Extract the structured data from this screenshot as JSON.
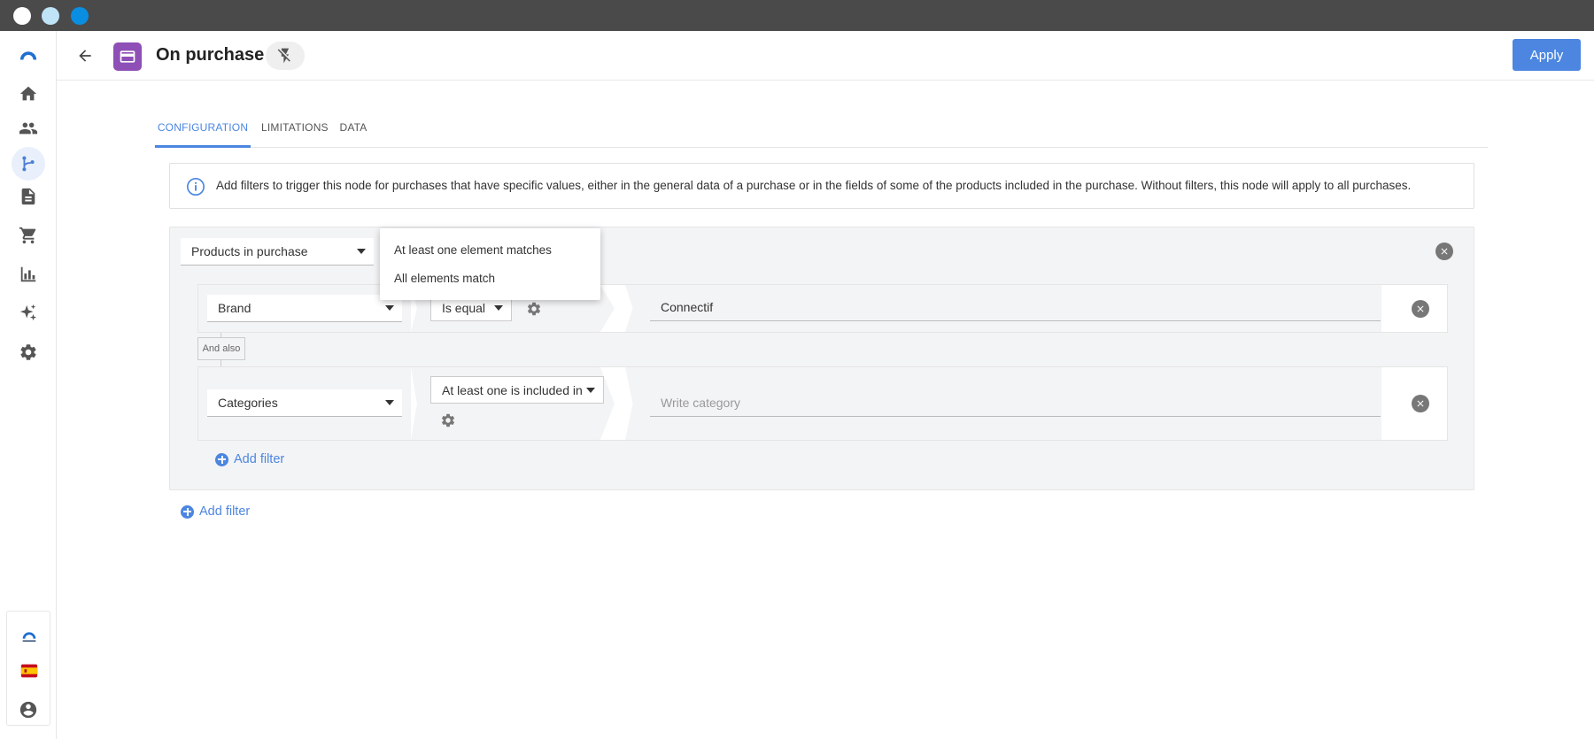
{
  "window": {
    "traffic_lights": [
      "white",
      "light-blue",
      "blue"
    ]
  },
  "header": {
    "title": "On purchase",
    "apply_label": "Apply"
  },
  "tabs": [
    {
      "label": "CONFIGURATION",
      "active": true
    },
    {
      "label": "LIMITATIONS",
      "active": false
    },
    {
      "label": "DATA",
      "active": false
    }
  ],
  "info": {
    "text": "Add filters to trigger this node for purchases that have specific values, either in the general data of a purchase or in the fields of some of the products included in the purchase. Without filters, this node will apply to all purchases."
  },
  "filter_group": {
    "source_select": "Products in purchase",
    "dropdown_options": [
      "At least one element matches",
      "All elements match"
    ],
    "rows": [
      {
        "field": "Brand",
        "operator": "Is equal",
        "value": "Connectif",
        "placeholder": ""
      },
      {
        "field": "Categories",
        "operator": "At least one is included in",
        "value": "",
        "placeholder": "Write category"
      }
    ],
    "connector_label": "And also",
    "add_filter_label": "Add filter"
  },
  "outer_add_filter_label": "Add filter",
  "colors": {
    "accent": "#4c86e0",
    "node_icon": "#8e4fb6",
    "titlebar": "#4a4a4a"
  },
  "sidebar_icons": [
    "home-icon",
    "users-icon",
    "workflow-icon",
    "document-icon",
    "cart-icon",
    "chart-icon",
    "sparkle-icon",
    "gear-icon"
  ]
}
